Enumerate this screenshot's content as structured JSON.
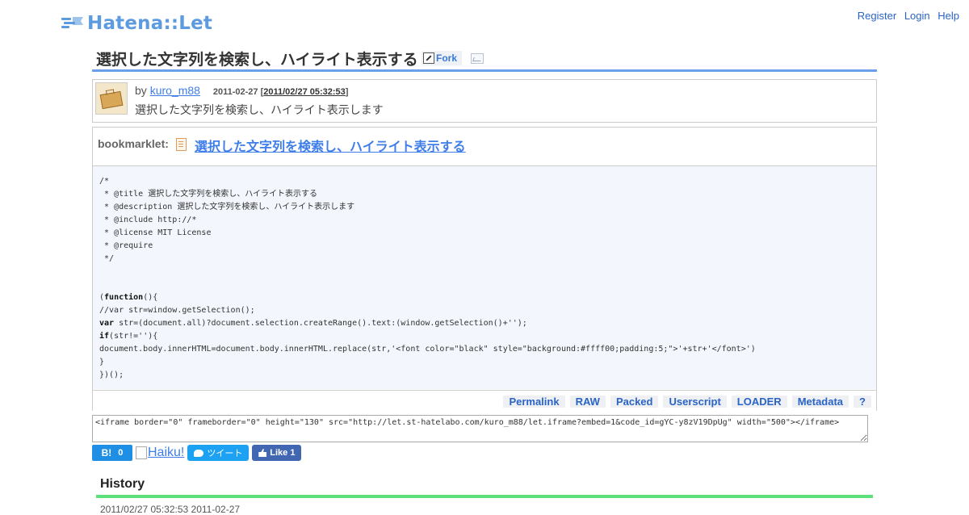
{
  "header": {
    "logo_text": "Hatena::Let",
    "nav": [
      "Register",
      "Login",
      "Help"
    ]
  },
  "page": {
    "title": "選択した文字列を検索し、ハイライト表示する",
    "fork_label": "Fork"
  },
  "author": {
    "by": "by",
    "name": "kuro_m88",
    "date": "2011-02-27",
    "timestamp": "2011/02/27 05:32:53",
    "description": "選択した文字列を検索し、ハイライト表示します"
  },
  "bookmarklet": {
    "label": "bookmarklet:",
    "link_text": "選択した文字列を検索し、ハイライト表示する",
    "code": [
      "/*",
      " * @title 選択した文字列を検索し、ハイライト表示する",
      " * @description 選択した文字列を検索し、ハイライト表示します",
      " * @include http://*",
      " * @license MIT License",
      " * @require",
      " */",
      "",
      "",
      "(function(){",
      "//var str=window.getSelection();",
      "var str=(document.all)?document.selection.createRange().text:(window.getSelection()+'');",
      "if(str!=''){",
      "document.body.innerHTML=document.body.innerHTML.replace(str,'<font color=\"black\" style=\"background:#ffff00;padding:5;\">'+str+'</font>')",
      "}",
      "})();"
    ],
    "actions": [
      "Permalink",
      "RAW",
      "Packed",
      "Userscript",
      "LOADER",
      "Metadata",
      "?"
    ]
  },
  "embed_code": "<iframe border=\"0\" frameborder=\"0\" height=\"130\" src=\"http://let.st-hatelabo.com/kuro_m88/let.iframe?embed=1&code_id=gYC-y8zV19DpUg\" width=\"500\"></iframe>",
  "social": {
    "hatena_label": "B!",
    "hatena_count": "0",
    "haiku_alt": "Haiku!",
    "tweet_label": "ツイート",
    "like_label": "Like 1"
  },
  "history": {
    "heading": "History",
    "entry_partial": "2011/02/27 05:32:53  2011-02-27"
  },
  "colors": {
    "accent_blue": "#6a9fea",
    "link": "#3f7ee8",
    "history_rule": "#5be07a",
    "code_bg": "#f3f6fc"
  }
}
